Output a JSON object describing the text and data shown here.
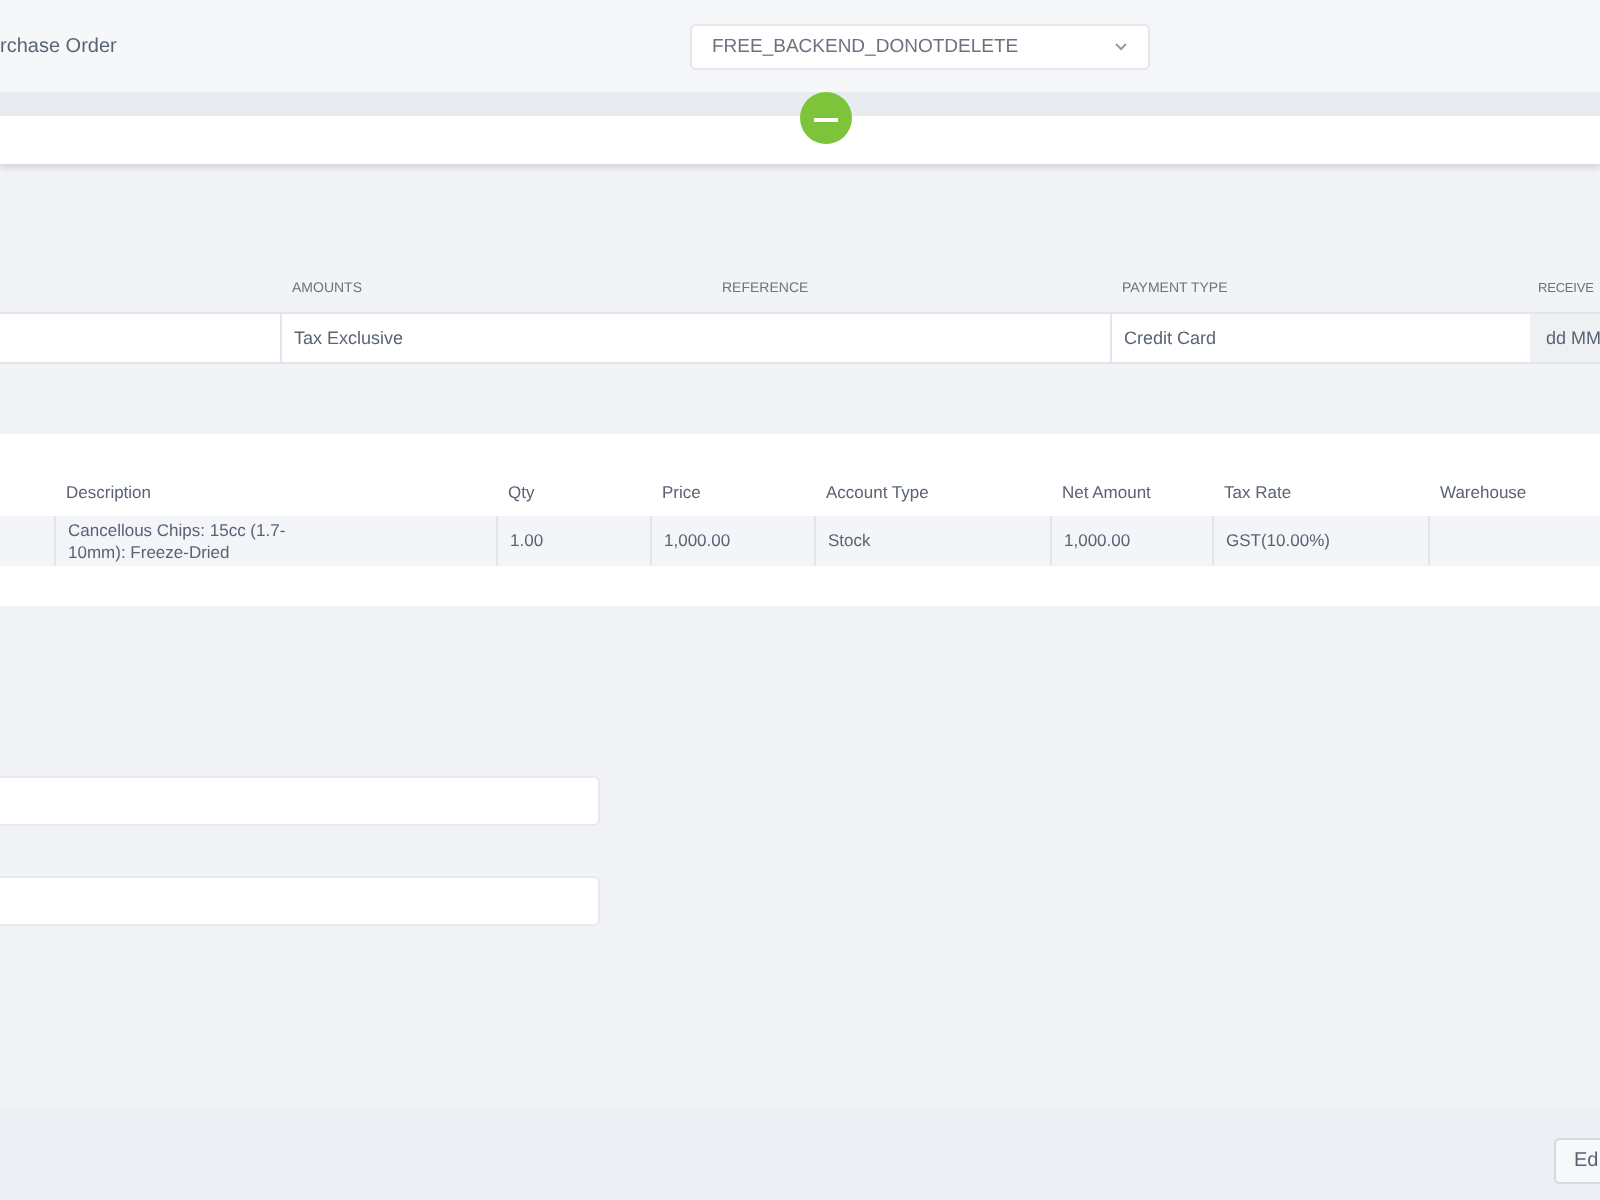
{
  "header": {
    "title": "rchase Order",
    "organisation_select": {
      "value": "FREE_BACKEND_DONOTDELETE"
    }
  },
  "details": {
    "columns": [
      {},
      {
        "label": "AMOUNTS",
        "value": "Tax Exclusive"
      },
      {
        "label": "REFERENCE"
      },
      {
        "label": "PAYMENT TYPE",
        "value": "Credit Card"
      },
      {
        "label": "RECEIVE",
        "placeholder": "dd MM"
      }
    ]
  },
  "lines": {
    "columns": [
      null,
      "Description",
      "Qty",
      "Price",
      "Account Type",
      "Net Amount",
      "Tax Rate",
      "Warehouse"
    ],
    "rows": [
      [
        null,
        "Cancellous Chips: 15cc (1.7-10mm): Freeze-Dried",
        "1.00",
        "1,000.00",
        "Stock",
        "1,000.00",
        "GST(10.00%)",
        null
      ]
    ]
  },
  "footer": {
    "button": "Ed"
  }
}
